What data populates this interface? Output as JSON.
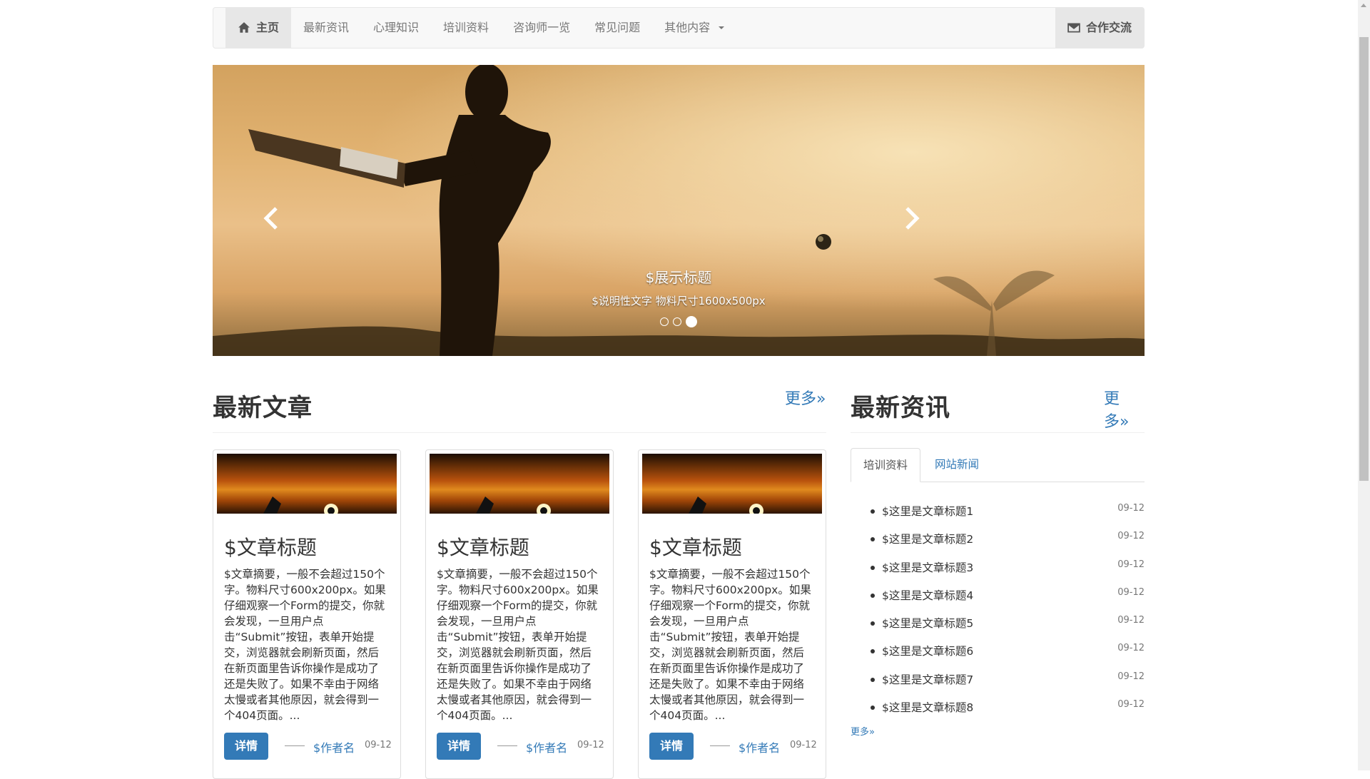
{
  "navbar": {
    "items": [
      {
        "label": "主页",
        "icon": "home-icon",
        "active": true
      },
      {
        "label": "最新资讯"
      },
      {
        "label": "心理知识"
      },
      {
        "label": "培训资料"
      },
      {
        "label": "咨询师一览"
      },
      {
        "label": "常见问题"
      },
      {
        "label": "其他内容",
        "dropdown": true
      }
    ],
    "right_item": {
      "label": "合作交流",
      "icon": "envelope-icon"
    }
  },
  "carousel": {
    "title": "$展示标题",
    "caption": "$说明性文字 物料尺寸1600x500px",
    "slides": 3,
    "active_slide": 3
  },
  "articles": {
    "heading": "最新文章",
    "more": "更多»",
    "cards": [
      {
        "title": "$文章标题",
        "summary": "$文章摘要，一般不会超过150个字。物料尺寸600x200px。如果仔细观察一个Form的提交，你就会发现，一旦用户点击“Submit”按钮，表单开始提交，浏览器就会刷新页面，然后在新页面里告诉你操作是成功了还是失败了。如果不幸由于网络太慢或者其他原因，就会得到一个404页面。...",
        "button": "详情",
        "author": "$作者名",
        "date": "09-12"
      },
      {
        "title": "$文章标题",
        "summary": "$文章摘要，一般不会超过150个字。物料尺寸600x200px。如果仔细观察一个Form的提交，你就会发现，一旦用户点击“Submit”按钮，表单开始提交，浏览器就会刷新页面，然后在新页面里告诉你操作是成功了还是失败了。如果不幸由于网络太慢或者其他原因，就会得到一个404页面。...",
        "button": "详情",
        "author": "$作者名",
        "date": "09-12"
      },
      {
        "title": "$文章标题",
        "summary": "$文章摘要，一般不会超过150个字。物料尺寸600x200px。如果仔细观察一个Form的提交，你就会发现，一旦用户点击“Submit”按钮，表单开始提交，浏览器就会刷新页面，然后在新页面里告诉你操作是成功了还是失败了。如果不幸由于网络太慢或者其他原因，就会得到一个404页面。...",
        "button": "详情",
        "author": "$作者名",
        "date": "09-12"
      }
    ]
  },
  "news": {
    "heading": "最新资讯",
    "more": "更多»",
    "tabs": [
      {
        "label": "培训资料",
        "active": true
      },
      {
        "label": "网站新闻",
        "active": false
      }
    ],
    "items": [
      {
        "title": "$这里是文章标题1",
        "date": "09-12"
      },
      {
        "title": "$这里是文章标题2",
        "date": "09-12"
      },
      {
        "title": "$这里是文章标题3",
        "date": "09-12"
      },
      {
        "title": "$这里是文章标题4",
        "date": "09-12"
      },
      {
        "title": "$这里是文章标题5",
        "date": "09-12"
      },
      {
        "title": "$这里是文章标题6",
        "date": "09-12"
      },
      {
        "title": "$这里是文章标题7",
        "date": "09-12"
      },
      {
        "title": "$这里是文章标题8",
        "date": "09-12"
      }
    ],
    "footer_more": "更多»"
  },
  "colors": {
    "link": "#337ab7",
    "button": "#337ab7",
    "navbar_bg": "#f8f8f8",
    "nav_active_bg": "#e7e7e7"
  }
}
